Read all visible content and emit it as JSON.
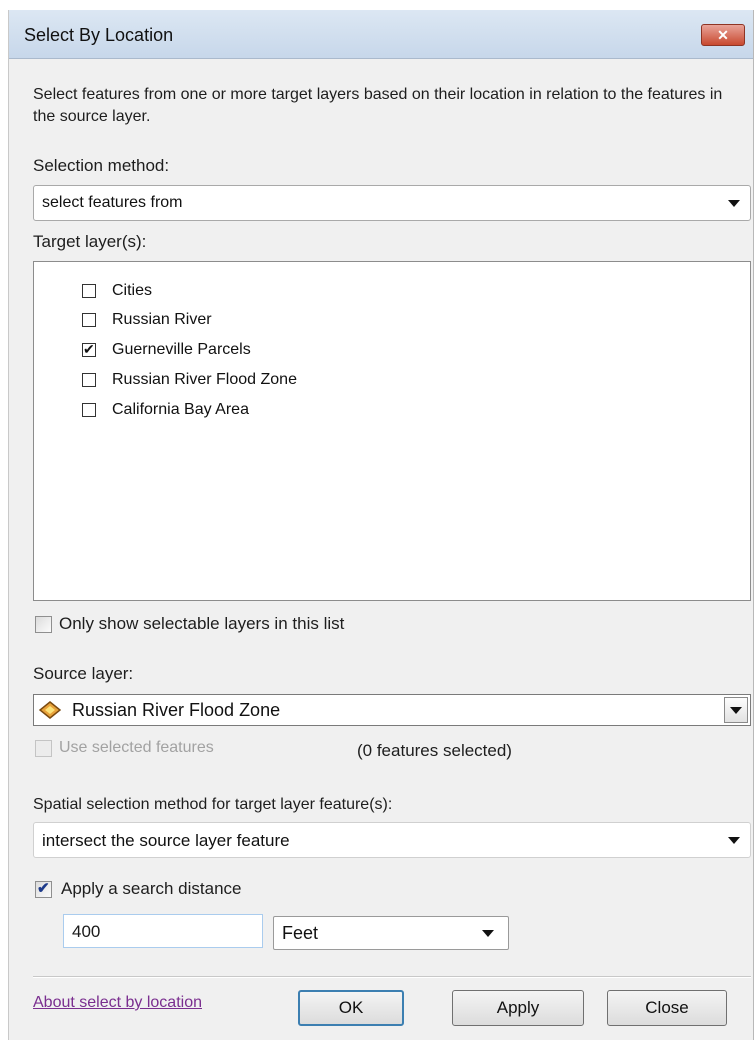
{
  "dialog": {
    "title": "Select By Location",
    "close_glyph": "✕",
    "description": "Select features from one or more target layers based on their location in relation to the features in the source layer."
  },
  "selection_method": {
    "label": "Selection method:",
    "value": "select features from"
  },
  "target_layers": {
    "label": "Target layer(s):",
    "items": [
      {
        "label": "Cities",
        "checked": false
      },
      {
        "label": "Russian River",
        "checked": false
      },
      {
        "label": "Guerneville Parcels",
        "checked": true
      },
      {
        "label": "Russian River Flood Zone",
        "checked": false
      },
      {
        "label": "California Bay Area",
        "checked": false
      }
    ]
  },
  "only_selectable": {
    "label": "Only show selectable layers in this list",
    "checked": false
  },
  "source_layer": {
    "label": "Source layer:",
    "value": "Russian River Flood Zone",
    "icon": "polygon-layer-icon"
  },
  "use_selected": {
    "label": "Use selected features",
    "checked": false,
    "disabled": true,
    "count_text": "(0 features selected)"
  },
  "spatial_method": {
    "label": "Spatial selection method for target layer feature(s):",
    "value": "intersect the source layer feature"
  },
  "search_distance": {
    "label": "Apply a search distance",
    "checked": true,
    "value": "400",
    "unit": "Feet"
  },
  "footer": {
    "help_link": "About select by location",
    "ok": "OK",
    "apply": "Apply",
    "close": "Close"
  },
  "colors": {
    "link": "#7a2e8f",
    "default_button_border": "#3c7fb1",
    "close_button": "#c8492f"
  }
}
